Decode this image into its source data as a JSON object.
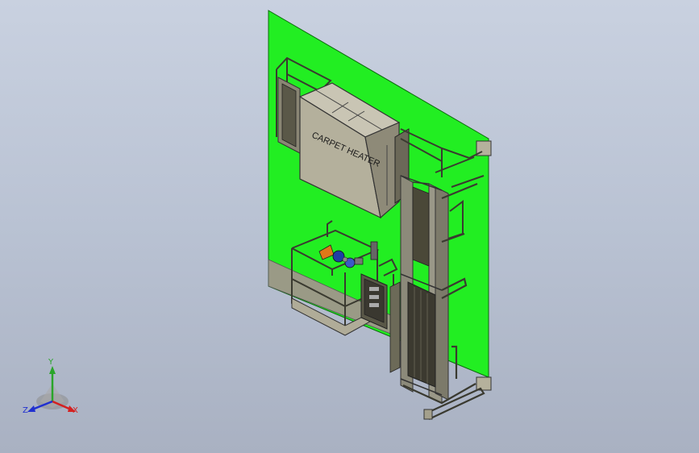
{
  "model": {
    "label_text": "CARPET HEATER"
  },
  "triad": {
    "x_label": "X",
    "y_label": "Y",
    "z_label": "Z"
  },
  "colors": {
    "background_top": "#c9d1e0",
    "background_bottom": "#a9b1c2",
    "wall_green": "#21f121",
    "frame_gray": "#8c8a7a",
    "x_axis": "#d42020",
    "y_axis": "#30b030",
    "z_axis": "#2030d0"
  }
}
